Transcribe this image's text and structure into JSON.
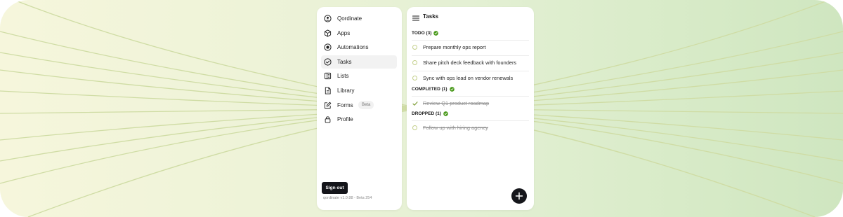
{
  "app": {
    "name": "Qordinate",
    "version_text": "qordinate v1.0.88 - Beta 254"
  },
  "sidebar": {
    "items": [
      {
        "label": "Qordinate",
        "icon": "user-circle-icon",
        "active": false
      },
      {
        "label": "Apps",
        "icon": "cube-icon",
        "active": false
      },
      {
        "label": "Automations",
        "icon": "target-icon",
        "active": false
      },
      {
        "label": "Tasks",
        "icon": "check-circle-icon",
        "active": true
      },
      {
        "label": "Lists",
        "icon": "list-icon",
        "active": false
      },
      {
        "label": "Library",
        "icon": "document-icon",
        "active": false
      },
      {
        "label": "Forms",
        "icon": "edit-icon",
        "active": false,
        "badge": "Beta"
      },
      {
        "label": "Profile",
        "icon": "lock-icon",
        "active": false
      }
    ],
    "signout_label": "Sign out"
  },
  "tasks": {
    "title": "Tasks",
    "sections": [
      {
        "label": "TODO (3)",
        "items": [
          "Prepare monthly ops report",
          "Share pitch deck feedback with founders",
          "Sync with ops lead on vendor renewals"
        ]
      },
      {
        "label": "COMPLETED (1)",
        "items": [
          "Review Q1 product roadmap"
        ]
      },
      {
        "label": "DROPPED (1)",
        "items": [
          "Follow up with hiring agency"
        ]
      }
    ]
  },
  "colors": {
    "accent_green": "#4a9a1c",
    "task_circle": "#c3cf8a",
    "dark": "#15161b"
  }
}
